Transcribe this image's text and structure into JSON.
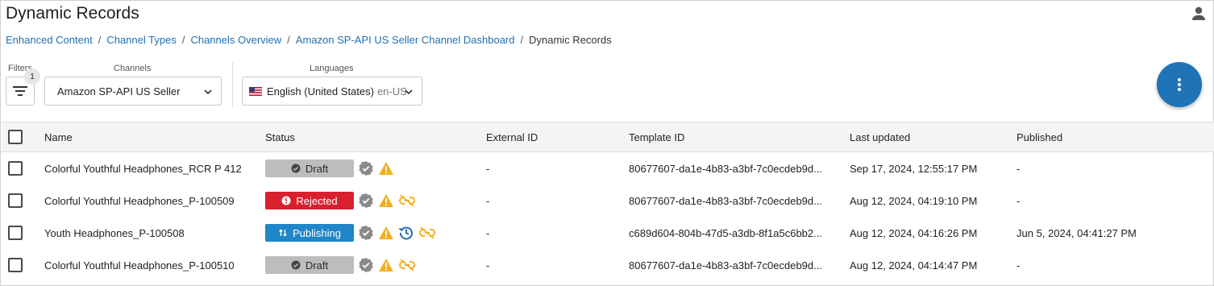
{
  "header": {
    "title": "Dynamic Records"
  },
  "breadcrumb": [
    {
      "label": "Enhanced Content"
    },
    {
      "label": "Channel Types"
    },
    {
      "label": "Channels Overview"
    },
    {
      "label": "Amazon SP-API US Seller Channel Dashboard"
    },
    {
      "label": "Dynamic Records"
    }
  ],
  "breadcrumb_separator": "/",
  "filters": {
    "label": "Filters",
    "count": "1",
    "channels_label": "Channels",
    "channel_value": "Amazon SP-API US Seller",
    "languages_label": "Languages",
    "language_value": "English (United States)",
    "language_code": "en-US"
  },
  "table": {
    "columns": [
      "Name",
      "Status",
      "External ID",
      "Template ID",
      "Last updated",
      "Published"
    ],
    "rows": [
      {
        "name": "Colorful Youthful Headphones_RCR P 412",
        "status": "Draft",
        "external_id": "-",
        "template_id": "80677607-da1e-4b83-a3bf-7c0ecdeb9d...",
        "last_updated": "Sep 17, 2024, 12:55:17 PM",
        "published": "-"
      },
      {
        "name": "Colorful Youthful Headphones_P-100509",
        "status": "Rejected",
        "external_id": "-",
        "template_id": "80677607-da1e-4b83-a3bf-7c0ecdeb9d...",
        "last_updated": "Aug 12, 2024, 04:19:10 PM",
        "published": "-"
      },
      {
        "name": "Youth Headphones_P-100508",
        "status": "Publishing",
        "external_id": "-",
        "template_id": "c689d604-804b-47d5-a3db-8f1a5c6bb2...",
        "last_updated": "Aug 12, 2024, 04:16:26 PM",
        "published": "Jun 5, 2024, 04:41:27 PM"
      },
      {
        "name": "Colorful Youthful Headphones_P-100510",
        "status": "Draft",
        "external_id": "-",
        "template_id": "80677607-da1e-4b83-a3bf-7c0ecdeb9d...",
        "last_updated": "Aug 12, 2024, 04:14:47 PM",
        "published": "-"
      }
    ]
  },
  "colors": {
    "link": "#1f6fb2",
    "fab": "#1f73b7",
    "draft": "#bdbdbd",
    "rejected": "#d9202f",
    "publishing": "#1f86c9",
    "warning": "#f2b01e",
    "verified": "#8a8a8a"
  }
}
